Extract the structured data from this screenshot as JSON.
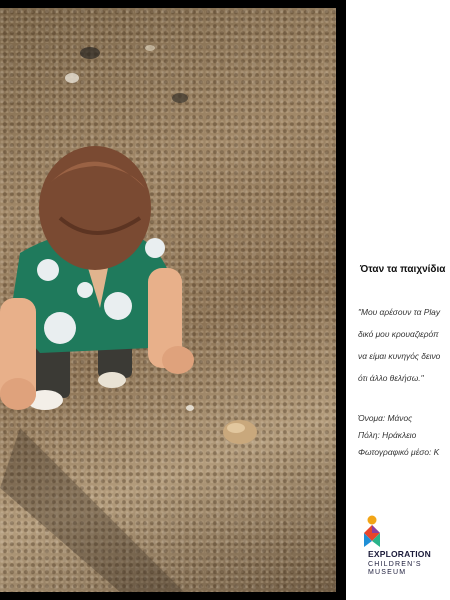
{
  "panel": {
    "title": "Όταν τα παιχνίδια",
    "quote_lines": [
      "\"Μου αρέσουν τα Play",
      "δικό μου κρουαζιερόπ",
      "να είμαι κυνηγός δεινο",
      "ότι άλλο θελήσω.\""
    ],
    "info_lines": [
      "Όνομα: Μάνος",
      "Πόλη: Ηράκλειο",
      "Φωτογραφικό μέσο: Κ"
    ],
    "brand": {
      "name": "EXPLORATION",
      "sub_line1": "CHILDREN'S",
      "sub_line2": "MUSEUM"
    }
  },
  "colors": {
    "shirt": "#1f7a5c",
    "hair": "#7a4a32",
    "sand": "#a18868",
    "brand_text": "#1b1b3a"
  }
}
